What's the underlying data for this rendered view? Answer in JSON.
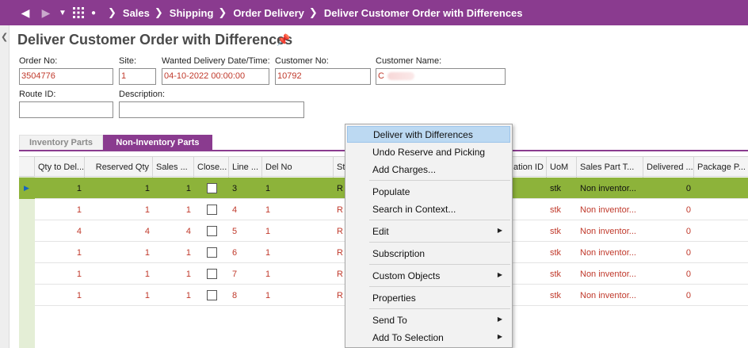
{
  "nav": {
    "back_icon": "back-arrow-icon",
    "forward_icon": "forward-arrow-icon",
    "breadcrumbs": [
      "Sales",
      "Shipping",
      "Order Delivery",
      "Deliver Customer Order with Differences"
    ]
  },
  "page": {
    "title": "Deliver Customer Order with Differences"
  },
  "form": {
    "order_no_label": "Order No:",
    "order_no_value": "3504776",
    "site_label": "Site:",
    "site_value": "1",
    "wanted_date_label": "Wanted Delivery Date/Time:",
    "wanted_date_value": "04-10-2022 00:00:00",
    "customer_no_label": "Customer No:",
    "customer_no_value": "10792",
    "customer_name_label": "Customer Name:",
    "customer_name_value": "C",
    "route_id_label": "Route ID:",
    "route_id_value": "",
    "description_label": "Description:",
    "description_value": ""
  },
  "tabs": [
    {
      "label": "Inventory Parts",
      "active": false
    },
    {
      "label": "Non-Inventory Parts",
      "active": true
    }
  ],
  "grid": {
    "columns": [
      "Qty to Del...",
      "Reserved Qty",
      "Sales ...",
      "Close...",
      "Line ...",
      "Del No",
      "St",
      "ation ID",
      "UoM",
      "Sales Part T...",
      "Delivered ...",
      "Package P..."
    ],
    "rows": [
      {
        "qty_to_del": "1",
        "reserved_qty": "1",
        "sales": "1",
        "line": "3",
        "del_no": "1",
        "status": "R",
        "uom": "stk",
        "sales_part_type": "Non inventor...",
        "delivered": "0",
        "selected": true
      },
      {
        "qty_to_del": "1",
        "reserved_qty": "1",
        "sales": "1",
        "line": "4",
        "del_no": "1",
        "status": "R",
        "uom": "stk",
        "sales_part_type": "Non inventor...",
        "delivered": "0",
        "selected": false
      },
      {
        "qty_to_del": "4",
        "reserved_qty": "4",
        "sales": "4",
        "line": "5",
        "del_no": "1",
        "status": "R",
        "uom": "stk",
        "sales_part_type": "Non inventor...",
        "delivered": "0",
        "selected": false
      },
      {
        "qty_to_del": "1",
        "reserved_qty": "1",
        "sales": "1",
        "line": "6",
        "del_no": "1",
        "status": "R",
        "uom": "stk",
        "sales_part_type": "Non inventor...",
        "delivered": "0",
        "selected": false
      },
      {
        "qty_to_del": "1",
        "reserved_qty": "1",
        "sales": "1",
        "line": "7",
        "del_no": "1",
        "status": "R",
        "uom": "stk",
        "sales_part_type": "Non inventor...",
        "delivered": "0",
        "selected": false
      },
      {
        "qty_to_del": "1",
        "reserved_qty": "1",
        "sales": "1",
        "line": "8",
        "del_no": "1",
        "status": "R",
        "uom": "stk",
        "sales_part_type": "Non inventor...",
        "delivered": "0",
        "selected": false
      }
    ]
  },
  "context_menu": {
    "items": [
      "Deliver with Differences",
      "Undo Reserve and Picking",
      "Add Charges...",
      "Populate",
      "Search in Context...",
      "Edit",
      "Subscription",
      "Custom Objects",
      "Properties",
      "Send To",
      "Add To Selection"
    ]
  },
  "colors": {
    "brand": "#8a3b8f",
    "selected_row": "#8db33a",
    "value_text": "#c0392b",
    "menu_highlight": "#bcd9f2"
  }
}
